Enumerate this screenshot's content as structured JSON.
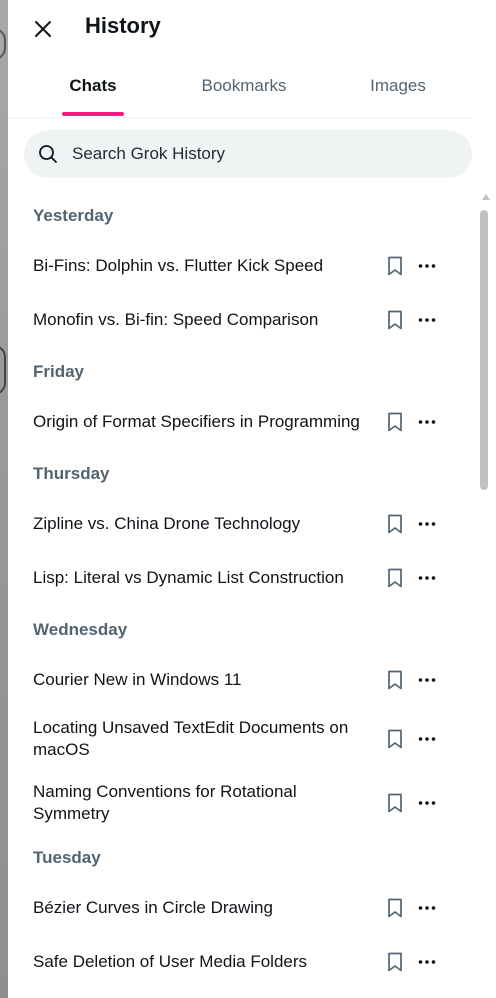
{
  "header": {
    "title": "History",
    "close_icon": "close-icon"
  },
  "tabs": [
    {
      "label": "Chats",
      "active": true
    },
    {
      "label": "Bookmarks",
      "active": false
    },
    {
      "label": "Images",
      "active": false
    }
  ],
  "colors": {
    "accent": "#f91880",
    "text": "#0f1419",
    "muted": "#536471",
    "search_bg": "#eff3f4"
  },
  "search": {
    "placeholder": "Search Grok History",
    "value": "",
    "icon": "search-icon"
  },
  "groups": [
    {
      "label": "Yesterday",
      "items": [
        {
          "title": "Bi-Fins: Dolphin vs. Flutter Kick Speed"
        },
        {
          "title": "Monofin vs. Bi-fin: Speed Comparison"
        }
      ]
    },
    {
      "label": "Friday",
      "items": [
        {
          "title": "Origin of Format Specifiers in Programming"
        }
      ]
    },
    {
      "label": "Thursday",
      "items": [
        {
          "title": "Zipline vs. China Drone Technology"
        },
        {
          "title": "Lisp: Literal vs Dynamic List Construction"
        }
      ]
    },
    {
      "label": "Wednesday",
      "items": [
        {
          "title": "Courier New in Windows 11"
        },
        {
          "title": "Locating Unsaved TextEdit Documents on macOS"
        },
        {
          "title": "Naming Conventions for Rotational Symmetry"
        }
      ]
    },
    {
      "label": "Tuesday",
      "items": [
        {
          "title": "Bézier Curves in Circle Drawing"
        },
        {
          "title": "Safe Deletion of User Media Folders"
        }
      ]
    }
  ],
  "item_actions": {
    "bookmark_icon": "bookmark-icon",
    "more_icon": "more-icon"
  }
}
